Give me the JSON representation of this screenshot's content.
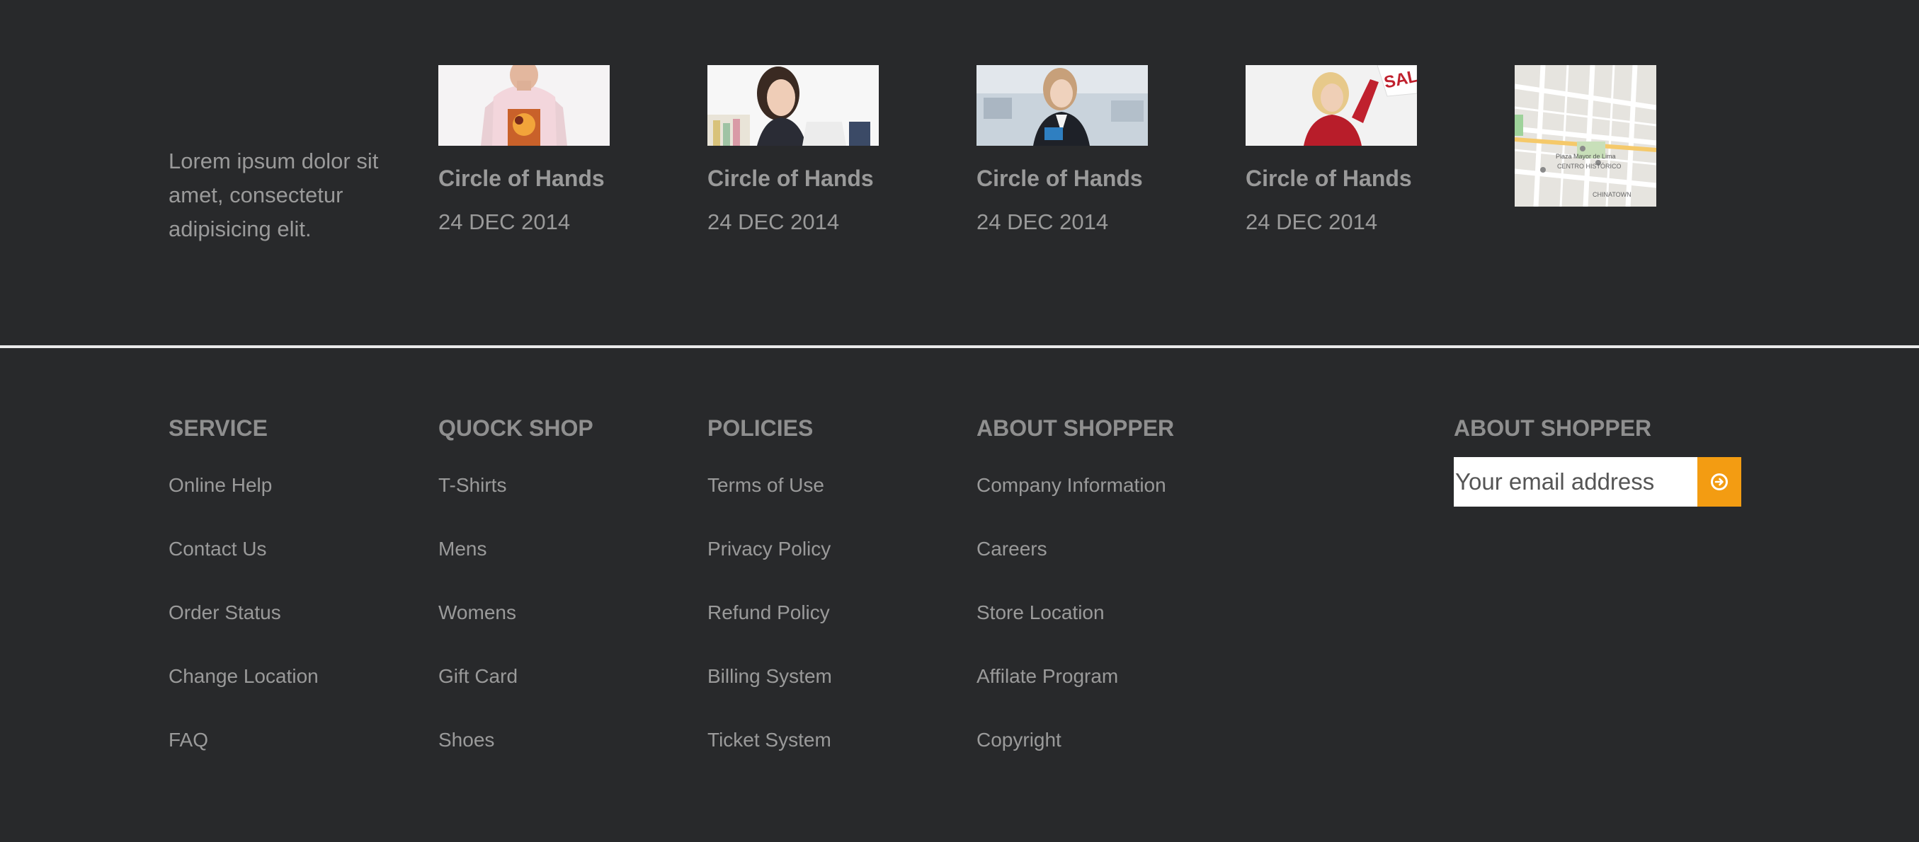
{
  "about": {
    "text": "Lorem ipsum dolor sit amet, consectetur adipisicing elit."
  },
  "posts": [
    {
      "title": "Circle of Hands",
      "date": "24 DEC 2014"
    },
    {
      "title": "Circle of Hands",
      "date": "24 DEC 2014"
    },
    {
      "title": "Circle of Hands",
      "date": "24 DEC 2014"
    },
    {
      "title": "Circle of Hands",
      "date": "24 DEC 2014"
    }
  ],
  "map": {
    "labels": [
      "Plaza Mayor de Lima",
      "CENTRO HISTÓRICO",
      "CHINATOWN"
    ]
  },
  "columns": [
    {
      "heading": "SERVICE",
      "links": [
        "Online Help",
        "Contact Us",
        "Order Status",
        "Change Location",
        "FAQ"
      ]
    },
    {
      "heading": "QUOCK SHOP",
      "links": [
        "T-Shirts",
        "Mens",
        "Womens",
        "Gift Card",
        "Shoes"
      ]
    },
    {
      "heading": "POLICIES",
      "links": [
        "Terms of Use",
        "Privacy Policy",
        "Refund Policy",
        "Billing System",
        "Ticket System"
      ]
    },
    {
      "heading": "ABOUT SHOPPER",
      "links": [
        "Company Information",
        "Careers",
        "Store Location",
        "Affilate Program",
        "Copyright"
      ]
    }
  ],
  "newsletter": {
    "heading": "ABOUT SHOPPER",
    "placeholder": "Your email address",
    "button_icon": "arrow-circle-right-icon"
  },
  "colors": {
    "background": "#28292b",
    "text": "#9a9a9a",
    "accent": "#f39c12",
    "divider": "#e9e9e9"
  }
}
